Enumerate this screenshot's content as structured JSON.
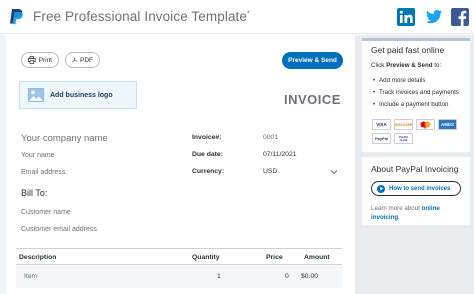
{
  "header": {
    "title": "Free Professional Invoice Template",
    "title_mark": "*"
  },
  "toolbar": {
    "print_label": "Print",
    "pdf_label": "PDF",
    "send_label": "Preview & Send"
  },
  "logo_box": {
    "label": "Add business logo"
  },
  "invoice": {
    "heading": "INVOICE",
    "company_placeholder": "Your company name",
    "name_placeholder": "Your name",
    "email_placeholder": "Email address",
    "bill_to_label": "Bill To:",
    "customer_name_placeholder": "Customer name",
    "customer_email_placeholder": "Customer email address",
    "fields": [
      {
        "label": "Invoice#:",
        "value": "0001"
      },
      {
        "label": "Due date:",
        "value": "07/11/2021"
      },
      {
        "label": "Currency:",
        "value": "USD"
      }
    ]
  },
  "table": {
    "columns": [
      "Description",
      "Quantity",
      "Price",
      "Amount"
    ],
    "rows": [
      {
        "description": "Item",
        "quantity": "1",
        "price": "0",
        "amount": "$0.00"
      }
    ]
  },
  "sidebar": {
    "promo": {
      "title": "Get paid fast online",
      "intro_prefix": "Click ",
      "intro_bold": "Preview & Send",
      "intro_suffix": " to:",
      "bullets": [
        "Add more details",
        "Track invoices and payments",
        "Include a payment button"
      ],
      "cards": [
        "VISA",
        "DISCOVER",
        "MC",
        "AMEX",
        "PayPal",
        "PayPal Credit"
      ]
    },
    "about": {
      "title": "About PayPal Invoicing",
      "button_label": "How to send invoices",
      "learn_prefix": "Learn more about ",
      "learn_link": "online invoicing",
      "learn_suffix": "."
    }
  },
  "colors": {
    "accent": "#0070ba",
    "sidebar_bg": "#e9ecee",
    "header_text": "#6c7378"
  },
  "icons": [
    "paypal-logo",
    "linkedin-icon",
    "twitter-icon",
    "facebook-icon",
    "print-icon",
    "pdf-icon",
    "image-icon",
    "chevron-down-icon",
    "play-icon"
  ]
}
